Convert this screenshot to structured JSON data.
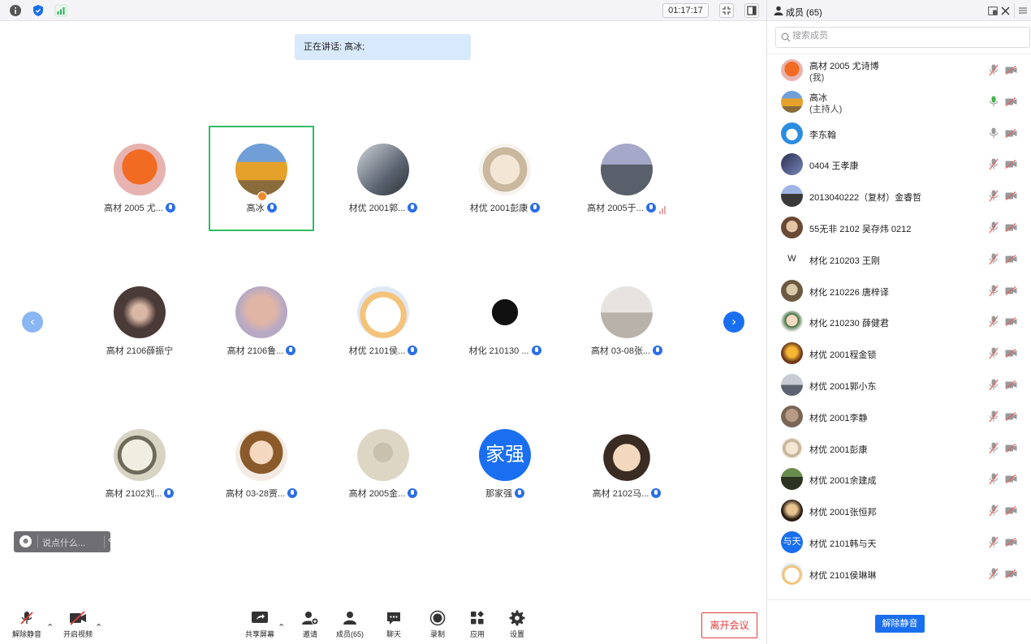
{
  "topbar": {
    "icons": [
      "info-icon",
      "shield-icon",
      "signal-icon"
    ],
    "timer": "01:17:17"
  },
  "speaking": "正在讲话: 高冰;",
  "colors": {
    "accent": "#1a6ff0",
    "active_border": "#2fbd63",
    "leave": "#e23b3b",
    "host_badge": "#f08a2c"
  },
  "grid": [
    {
      "name": "高材 2005 尤...",
      "mic": true
    },
    {
      "name": "高冰",
      "mic": true,
      "active": true,
      "host": true
    },
    {
      "name": "材优 2001郭...",
      "mic": true
    },
    {
      "name": "材优 2001彭康",
      "mic": true
    },
    {
      "name": "高材 2005于...",
      "mic": true,
      "signal": true
    },
    {
      "name": "高材 2106薛振宁",
      "mic": false
    },
    {
      "name": "高材 2106鲁...",
      "mic": true
    },
    {
      "name": "材优 2101侯...",
      "mic": true
    },
    {
      "name": "材化 210130 ...",
      "mic": true
    },
    {
      "name": "高材 03-08张...",
      "mic": true
    },
    {
      "name": "高材 2102刘...",
      "mic": true
    },
    {
      "name": "高材 03-28贾...",
      "mic": true
    },
    {
      "name": "高材 2005金...",
      "mic": true
    },
    {
      "name": "那家强",
      "mic": true,
      "avatar_text": "家强"
    },
    {
      "name": "高材 2102马...",
      "mic": true
    }
  ],
  "chat": {
    "placeholder": "说点什么..."
  },
  "toolbar": {
    "unmute": "解除静音",
    "start_video": "开启视频",
    "share": "共享屏幕",
    "invite": "邀请",
    "members": "成员(65)",
    "chat": "聊天",
    "record": "录制",
    "apps": "应用",
    "settings": "设置",
    "leave": "离开会议"
  },
  "panel": {
    "title": "成员 (65)",
    "search_placeholder": "搜索成员",
    "members": [
      {
        "name": "高材 2005 尤诗博",
        "sub": "(我)"
      },
      {
        "name": "高冰",
        "sub": "(主持人)",
        "speaking": true
      },
      {
        "name": "李东翰",
        "mic_on": true
      },
      {
        "name": "0404 王孝康"
      },
      {
        "name": "2013040222（复材）金睿哲"
      },
      {
        "name": "55无非 2102 吴存炜 0212"
      },
      {
        "name": "材化 210203 王刚",
        "avatar_text": "W"
      },
      {
        "name": "材化 210226 唐梓译"
      },
      {
        "name": "材化 210230 薛健君"
      },
      {
        "name": "材优 2001程金锁"
      },
      {
        "name": "材优 2001郭小东"
      },
      {
        "name": "材优 2001李静"
      },
      {
        "name": "材优 2001彭康"
      },
      {
        "name": "材优 2001余建成"
      },
      {
        "name": "材优 2001张恒邦"
      },
      {
        "name": "材优 2101韩与天",
        "avatar_text": "与天"
      },
      {
        "name": "材优 2101侯琳琳"
      }
    ],
    "unmute_all": "解除静音"
  }
}
